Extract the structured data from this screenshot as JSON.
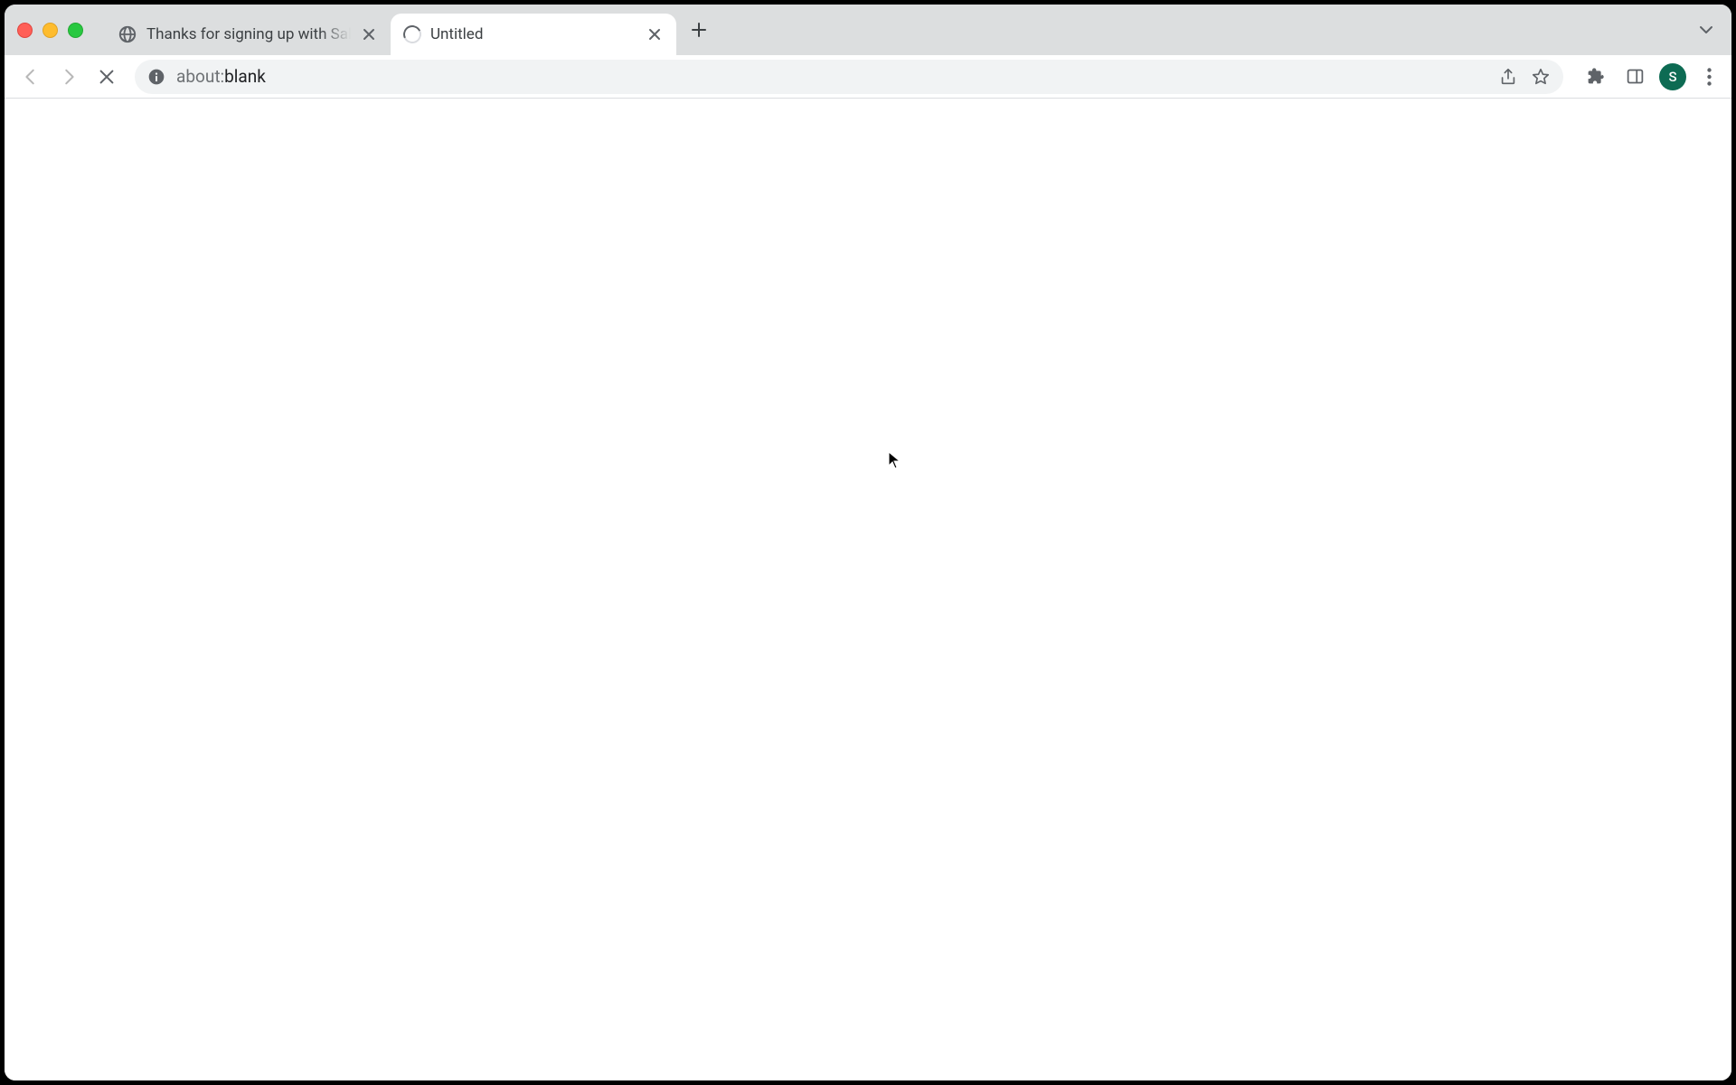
{
  "window": {
    "traffic_lights": [
      "close",
      "minimize",
      "maximize"
    ]
  },
  "tabs": [
    {
      "title": "Thanks for signing up with Salesforce",
      "favicon": "globe",
      "active": false
    },
    {
      "title": "Untitled",
      "favicon": "spinner",
      "active": true
    }
  ],
  "toolbar": {
    "back_enabled": false,
    "forward_enabled": false,
    "loading": true
  },
  "omnibox": {
    "url_dim": "about:",
    "url_strong": "blank"
  },
  "profile": {
    "initial": "S",
    "color": "#0d6b53"
  }
}
